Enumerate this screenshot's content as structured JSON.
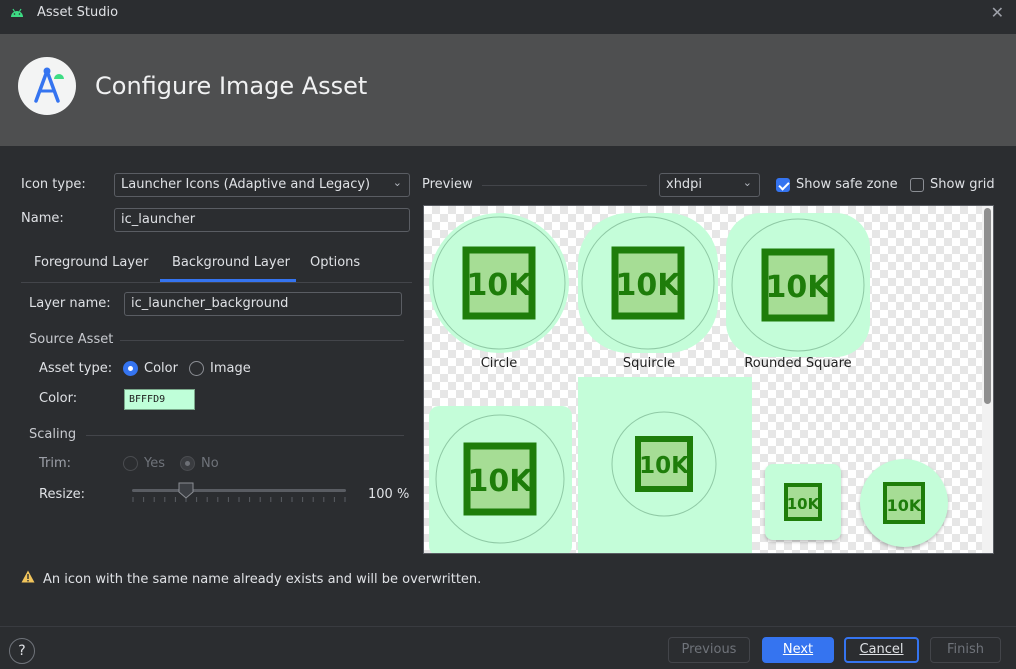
{
  "window": {
    "title": "Asset Studio"
  },
  "banner": {
    "heading": "Configure Image Asset"
  },
  "form": {
    "icon_type_label": "Icon type:",
    "icon_type_value": "Launcher Icons (Adaptive and Legacy)",
    "name_label": "Name:",
    "name_value": "ic_launcher"
  },
  "tabs": [
    {
      "label": "Foreground Layer",
      "selected": false
    },
    {
      "label": "Background Layer",
      "selected": true
    },
    {
      "label": "Options",
      "selected": false
    }
  ],
  "layer": {
    "layer_name_label": "Layer name:",
    "layer_name_value": "ic_launcher_background",
    "source_asset_label": "Source Asset",
    "asset_type_label": "Asset type:",
    "asset_type_options": [
      "Color",
      "Image"
    ],
    "asset_type_selected": "Color",
    "color_label": "Color:",
    "color_value": "BFFFD9",
    "scaling_label": "Scaling",
    "trim_label": "Trim:",
    "trim_options": [
      "Yes",
      "No"
    ],
    "trim_selected": "No",
    "resize_label": "Resize:",
    "resize_value": "100 %",
    "resize_percent": 100
  },
  "preview": {
    "label": "Preview",
    "density": "xhdpi",
    "show_safe_zone_label": "Show safe zone",
    "show_safe_zone": true,
    "show_grid_label": "Show grid",
    "show_grid": false,
    "shapes": [
      "Circle",
      "Squircle",
      "Rounded Square"
    ],
    "icon_text": "10K",
    "background_color": "#bfffd9",
    "icon_color": "#1e7d0a"
  },
  "warning": {
    "icon": "warning-icon",
    "text": "An icon with the same name already exists and will be overwritten."
  },
  "footer": {
    "help": "?",
    "previous": "Previous",
    "next": "Next",
    "cancel": "Cancel",
    "finish": "Finish"
  }
}
